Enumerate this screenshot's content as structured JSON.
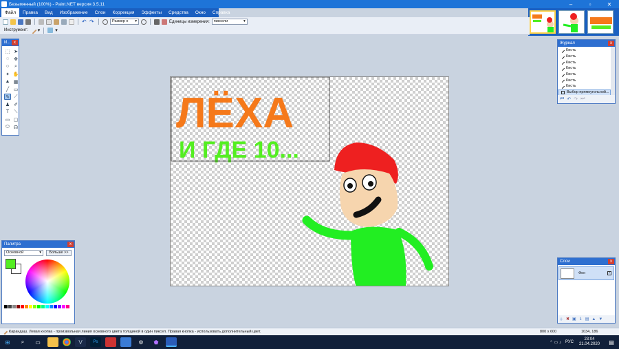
{
  "window": {
    "title": "Безымянный (100%) - Paint.NET версия 3.5.11"
  },
  "menu": [
    "Файл",
    "Правка",
    "Вид",
    "Изображение",
    "Слои",
    "Коррекция",
    "Эффекты",
    "Средства",
    "Окно",
    "Справка"
  ],
  "toolbar": {
    "zoom_value": "Размер о",
    "units_label": "Единицы измерения:",
    "units_value": "пиксели"
  },
  "toolbar2": {
    "tool_label": "Инструмент:"
  },
  "canvas": {
    "line1": "ЛЁХА",
    "line2": "И ГДЕ 10..."
  },
  "tools_panel": {
    "title": "И..."
  },
  "history_panel": {
    "title": "Журнал",
    "items": [
      "Кисть",
      "Кисть",
      "Кисть",
      "Кисть",
      "Кисть",
      "Кисть",
      "Кисть",
      "Выбор прямоугольной..."
    ]
  },
  "palette_panel": {
    "title": "Палитра",
    "mode": "Основной",
    "more_button": "Больше >>",
    "primary_color": "#55ee22",
    "secondary_color": "#ffffff"
  },
  "layers_panel": {
    "title": "Слои",
    "layer_name": "Фон"
  },
  "status": {
    "hint": "Карандаш. Левая кнопка - произвольная линия основного цвета толщиной в один пиксел. Правая кнопка - использовать дополнительный цвет.",
    "size": "800 x 600",
    "cursor": "1034, 186"
  },
  "taskbar": {
    "lang": "РУС",
    "time": "23:04",
    "date": "21.04.2020"
  }
}
